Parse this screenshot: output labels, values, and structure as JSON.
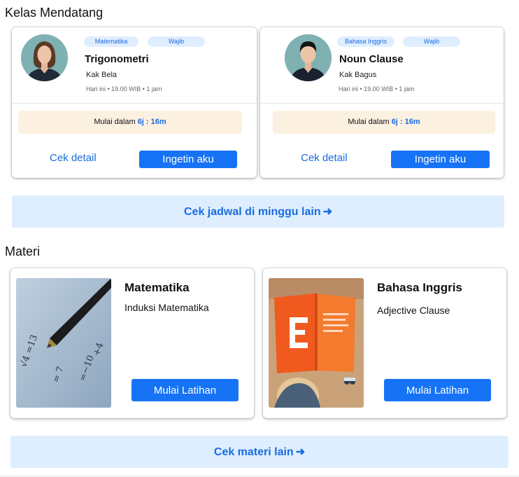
{
  "sections": {
    "upcoming_title": "Kelas Mendatang",
    "materials_title": "Materi"
  },
  "classes": [
    {
      "subject_tag": "Matematika",
      "type_tag": "Wajib",
      "title": "Trigonometri",
      "teacher": "Kak Bela",
      "meta": "Hari ini • 19.00 WIB • 1 jam",
      "countdown_prefix": "Mulai dalam ",
      "countdown_time": "6j : 16m",
      "detail_label": "Cek detail",
      "remind_label": "Ingetin aku",
      "avatar_icon": "female-avatar-icon"
    },
    {
      "subject_tag": "Bahasa Inggris",
      "type_tag": "Wajib",
      "title": "Noun Clause",
      "teacher": "Kak Bagus",
      "meta": "Hari ini • 19.00 WIB • 1 jam",
      "countdown_prefix": "Mulai dalam ",
      "countdown_time": "6j : 16m",
      "detail_label": "Cek detail",
      "remind_label": "Ingetin aku",
      "avatar_icon": "male-avatar-icon"
    }
  ],
  "schedule_button": {
    "label": "Cek jadwal di minggu lain",
    "arrow": "➜"
  },
  "materials": [
    {
      "title": "Matematika",
      "subtitle": "Induksi Matematika",
      "action_label": "Mulai Latihan",
      "image_icon": "pen-math-photo"
    },
    {
      "title": "Bahasa Inggris",
      "subtitle": "Adjective Clause",
      "action_label": "Mulai Latihan",
      "image_icon": "book-reading-photo"
    }
  ],
  "materials_button": {
    "label": "Cek materi lain",
    "arrow": "➜"
  },
  "colors": {
    "accent": "#1673f5",
    "light_blue": "#dfeeff",
    "countdown_bg": "#fcf1e1"
  }
}
